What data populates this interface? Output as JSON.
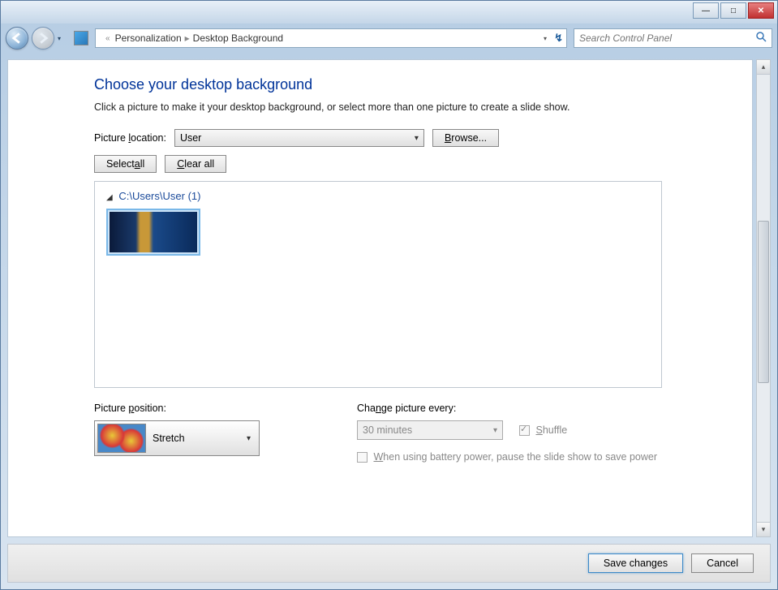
{
  "titlebar": {
    "minimize": "—",
    "maximize": "□",
    "close": "✕"
  },
  "breadcrumb": {
    "prefix": "«",
    "parent": "Personalization",
    "current": "Desktop Background"
  },
  "search": {
    "placeholder": "Search Control Panel"
  },
  "heading": "Choose your desktop background",
  "subtext": "Click a picture to make it your desktop background, or select more than one picture to create a slide show.",
  "picture_location": {
    "label_pre": "Picture ",
    "label_u": "l",
    "label_post": "ocation:",
    "value": "User",
    "browse_u": "B",
    "browse_post": "rowse..."
  },
  "select_all": {
    "pre": "Select ",
    "u": "a",
    "post": "ll"
  },
  "clear_all": {
    "u": "C",
    "post": "lear all"
  },
  "group": {
    "path": "C:\\Users\\User",
    "count": "(1)"
  },
  "position": {
    "label_pre": "Picture ",
    "label_u": "p",
    "label_post": "osition:",
    "value": "Stretch"
  },
  "change": {
    "label_pre": "Cha",
    "label_u": "n",
    "label_post": "ge picture every:",
    "value": "30 minutes"
  },
  "shuffle": {
    "u": "S",
    "post": "huffle"
  },
  "battery": {
    "u": "W",
    "post": "hen using battery power, pause the slide show to save power"
  },
  "footer": {
    "save": "Save changes",
    "cancel": "Cancel"
  }
}
